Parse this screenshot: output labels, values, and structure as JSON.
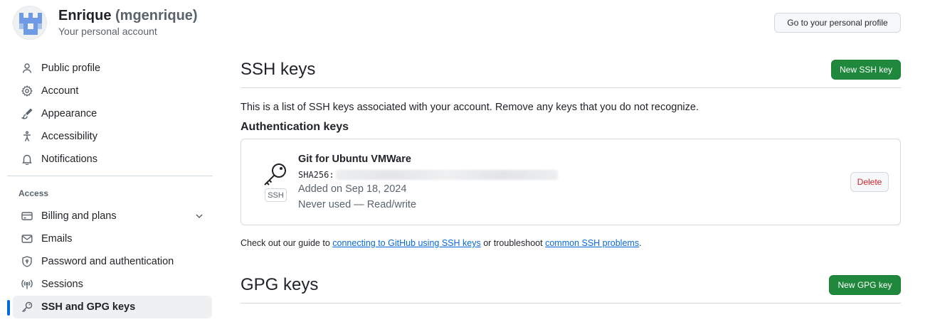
{
  "header": {
    "name": "Enrique",
    "handle": "(mgenrique)",
    "subtitle": "Your personal account",
    "profile_button": "Go to your personal profile"
  },
  "sidebar": {
    "items": [
      {
        "label": "Public profile",
        "icon": "person-icon"
      },
      {
        "label": "Account",
        "icon": "gear-icon"
      },
      {
        "label": "Appearance",
        "icon": "paintbrush-icon"
      },
      {
        "label": "Accessibility",
        "icon": "accessibility-icon"
      },
      {
        "label": "Notifications",
        "icon": "bell-icon"
      }
    ],
    "access_label": "Access",
    "access_items": [
      {
        "label": "Billing and plans",
        "icon": "credit-card-icon"
      },
      {
        "label": "Emails",
        "icon": "mail-icon"
      },
      {
        "label": "Password and authentication",
        "icon": "shield-lock-icon"
      },
      {
        "label": "Sessions",
        "icon": "broadcast-icon"
      },
      {
        "label": "SSH and GPG keys",
        "icon": "key-icon"
      }
    ]
  },
  "main": {
    "ssh_title": "SSH keys",
    "new_ssh_button": "New SSH key",
    "intro": "This is a list of SSH keys associated with your account. Remove any keys that you do not recognize.",
    "auth_title": "Authentication keys",
    "key": {
      "title": "Git for Ubuntu VMWare",
      "fingerprint_label": "SHA256:",
      "type_label": "SSH",
      "added": "Added on Sep 18, 2024",
      "usage": "Never used — Read/write",
      "delete_button": "Delete"
    },
    "guide": {
      "prefix": "Check out our guide to",
      "link1": "connecting to GitHub using SSH keys",
      "middle": "or troubleshoot",
      "link2": "common SSH problems",
      "suffix": "."
    },
    "gpg_title": "GPG keys",
    "new_gpg_button": "New GPG key"
  },
  "colors": {
    "primary_button": "#1f883d",
    "link": "#0969da",
    "danger": "#d1242f",
    "active_indicator": "#0969da",
    "avatar": "#6f9be6"
  }
}
